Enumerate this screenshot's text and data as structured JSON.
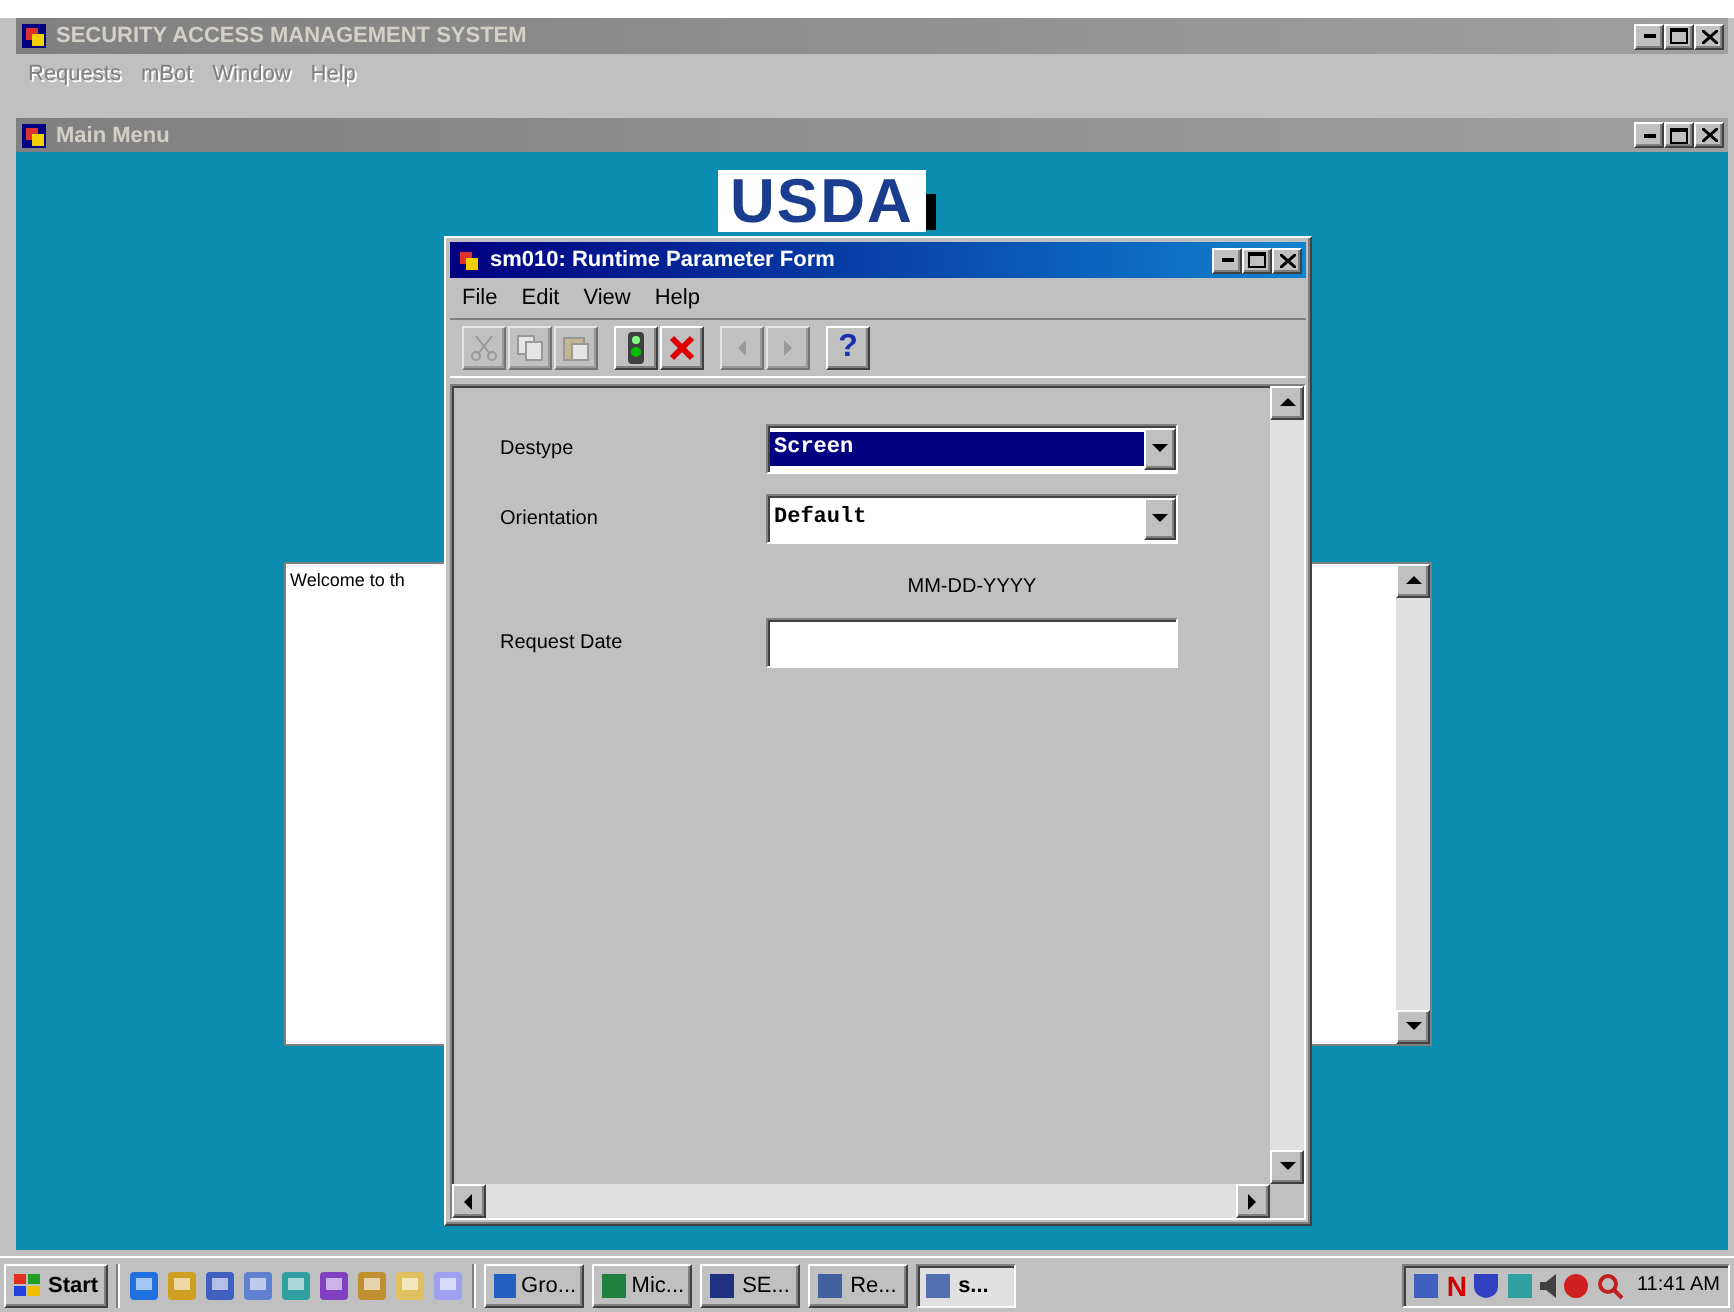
{
  "app": {
    "title": "SECURITY ACCESS MANAGEMENT SYSTEM",
    "active": false
  },
  "menu": [
    {
      "label": "Requests",
      "disabled": true
    },
    {
      "label": "mBot",
      "disabled": true
    },
    {
      "label": "Window",
      "disabled": true
    },
    {
      "label": "Help",
      "disabled": true
    }
  ],
  "child": {
    "title": "Main Menu",
    "active": false
  },
  "logo": "USDA",
  "welcome": {
    "text": "Welcome to th"
  },
  "dialog": {
    "title": "sm010: Runtime Parameter Form",
    "active": true,
    "menu": [
      "File",
      "Edit",
      "View",
      "Help"
    ],
    "toolbar": [
      [
        {
          "kind": "cut",
          "disabled": true
        },
        {
          "kind": "copy",
          "disabled": true
        },
        {
          "kind": "paste",
          "disabled": true
        }
      ],
      [
        {
          "kind": "run",
          "disabled": false
        },
        {
          "kind": "cancel",
          "disabled": false
        }
      ],
      [
        {
          "kind": "prev",
          "disabled": true
        },
        {
          "kind": "next",
          "disabled": true
        }
      ],
      [
        {
          "kind": "help",
          "label": "?",
          "disabled": false
        }
      ]
    ],
    "fields": [
      {
        "kind": "select",
        "label": "Destype",
        "value": "Screen",
        "selected": true
      },
      {
        "kind": "select",
        "label": "Orientation",
        "value": "Default",
        "selected": false
      },
      {
        "kind": "hint",
        "text": "MM-DD-YYYY"
      },
      {
        "kind": "input",
        "label": "Request Date"
      }
    ]
  },
  "taskbar": {
    "start": "Start",
    "tasks": [
      {
        "label": "Gro...",
        "selected": false
      },
      {
        "label": "Mic...",
        "selected": false
      },
      {
        "label": "SE...",
        "selected": false
      },
      {
        "label": "Re...",
        "selected": false
      },
      {
        "label": "s...",
        "selected": true
      }
    ],
    "tray_glyph": "N",
    "clock": "11:41 AM"
  }
}
